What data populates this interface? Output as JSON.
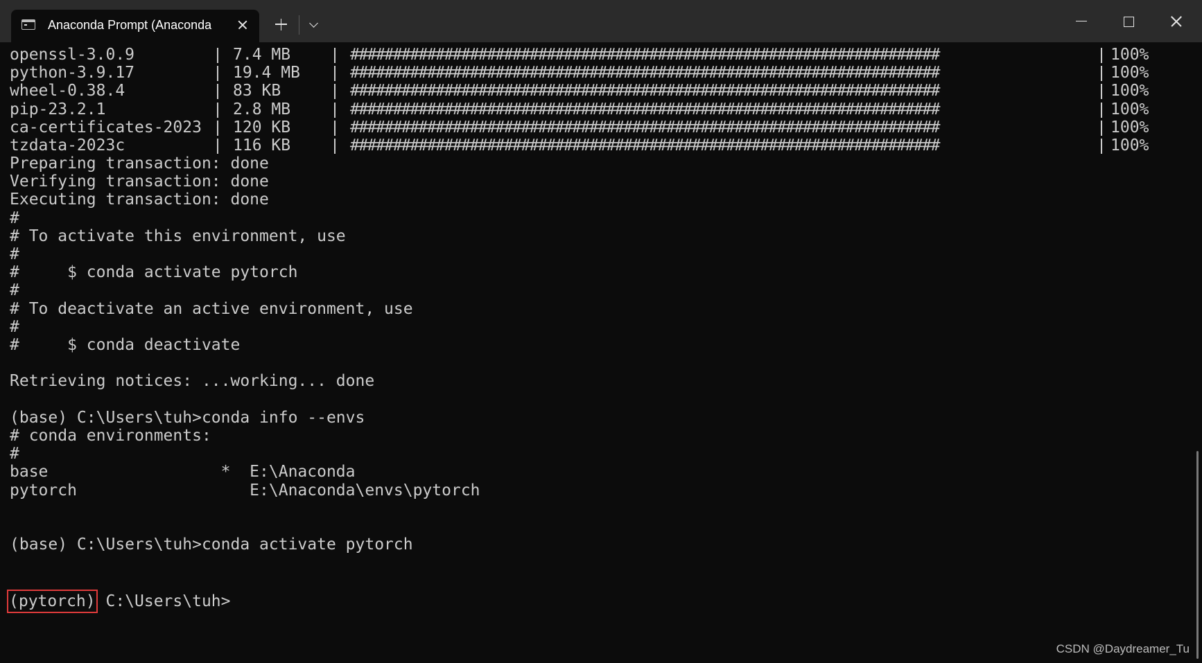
{
  "tab": {
    "title": "Anaconda Prompt (Anaconda",
    "icon": "terminal-icon"
  },
  "window_controls": [
    "minimize-icon",
    "maximize-icon",
    "close-icon"
  ],
  "packages": [
    {
      "name": "openssl-3.0.9",
      "size": "7.4 MB",
      "bar": "#####################################################################",
      "percent": "100%"
    },
    {
      "name": "python-3.9.17",
      "size": "19.4 MB",
      "bar": "#####################################################################",
      "percent": "100%"
    },
    {
      "name": "wheel-0.38.4",
      "size": "83 KB",
      "bar": "#####################################################################",
      "percent": "100%"
    },
    {
      "name": "pip-23.2.1",
      "size": "2.8 MB",
      "bar": "#####################################################################",
      "percent": "100%"
    },
    {
      "name": "ca-certificates-2023",
      "size": "120 KB",
      "bar": "#####################################################################",
      "percent": "100%"
    },
    {
      "name": "tzdata-2023c",
      "size": "116 KB",
      "bar": "#####################################################################",
      "percent": "100%"
    }
  ],
  "lines": [
    "Preparing transaction: done",
    "Verifying transaction: done",
    "Executing transaction: done",
    "#",
    "# To activate this environment, use",
    "#",
    "#     $ conda activate pytorch",
    "#",
    "# To deactivate an active environment, use",
    "#",
    "#     $ conda deactivate",
    "",
    "Retrieving notices: ...working... done",
    "",
    "(base) C:\\Users\\tuh>conda info --envs",
    "# conda environments:",
    "#",
    "base                  *  E:\\Anaconda",
    "pytorch                  E:\\Anaconda\\envs\\pytorch",
    "",
    "",
    "(base) C:\\Users\\tuh>conda activate pytorch",
    ""
  ],
  "prompt": {
    "env": "(pytorch)",
    "path": " C:\\Users\\tuh>"
  },
  "watermark": "CSDN @Daydreamer_Tu"
}
